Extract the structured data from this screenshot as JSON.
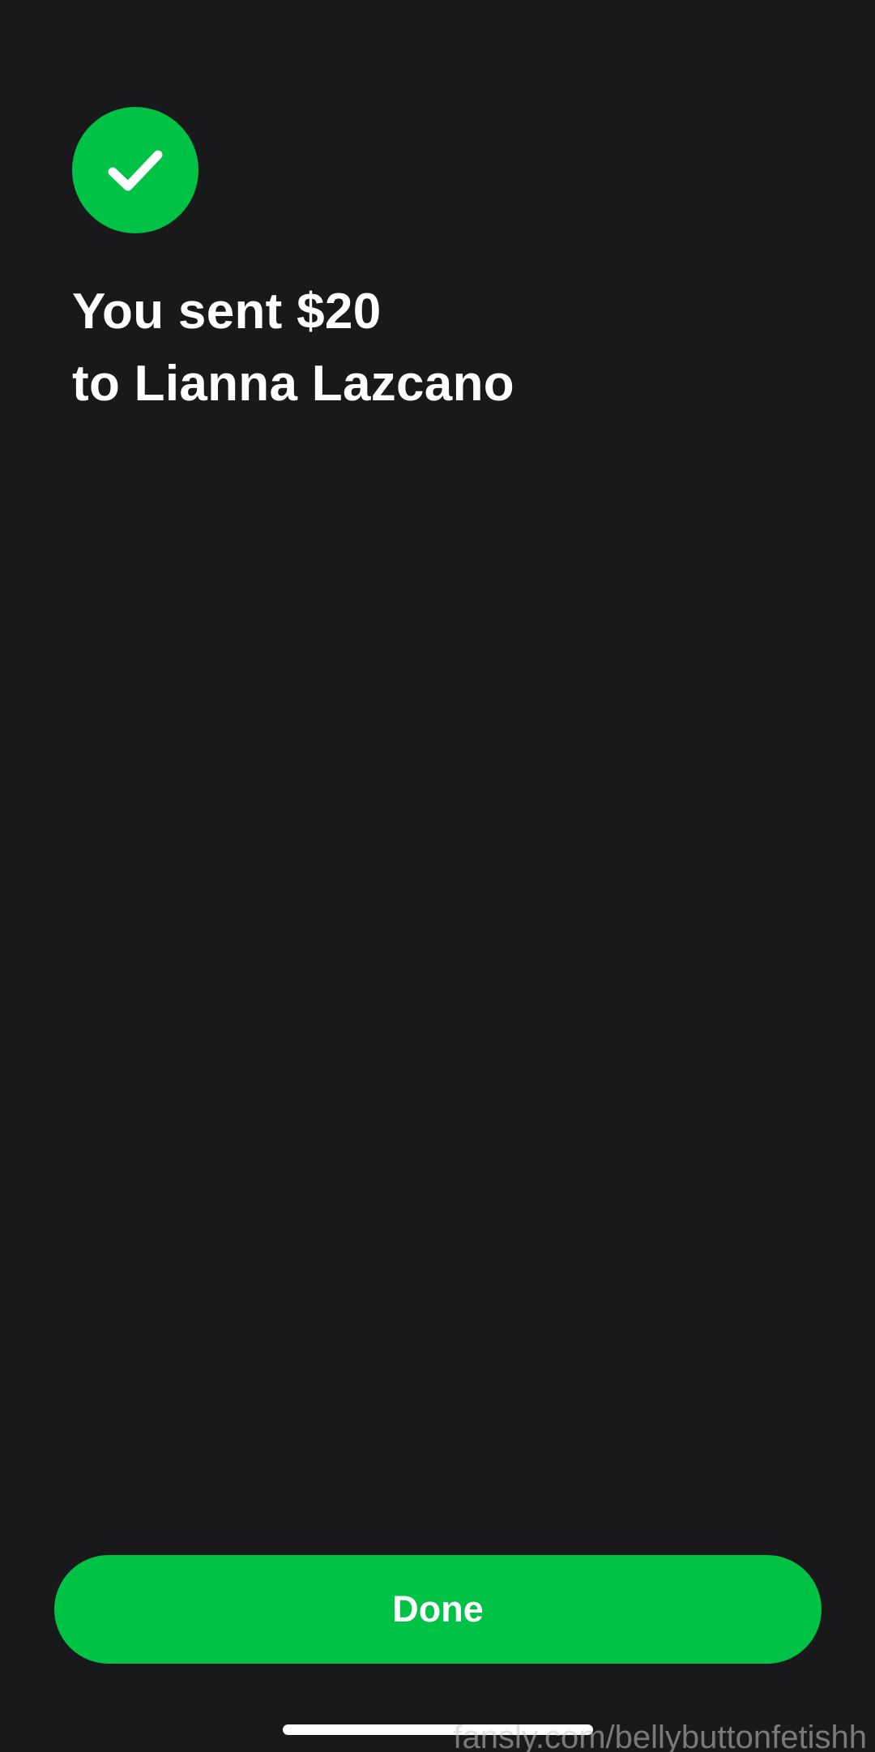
{
  "confirmation": {
    "icon": "checkmark-icon",
    "headline_line1": "You sent $20",
    "headline_line2": "to Lianna Lazcano"
  },
  "actions": {
    "done_label": "Done"
  },
  "watermark": {
    "text": "fansly.com/bellybuttonfetishh"
  },
  "colors": {
    "background": "#19191b",
    "accent_green": "#00c244",
    "text": "#ffffff"
  }
}
